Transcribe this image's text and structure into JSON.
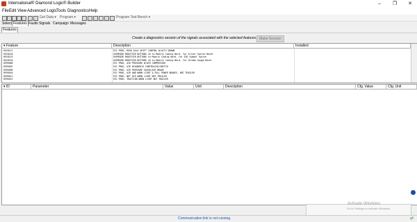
{
  "window": {
    "title": "International® Diamond Logic® Builder",
    "controls": [
      "–",
      "❐",
      "✕"
    ]
  },
  "menu": [
    "File",
    "Edit",
    "View",
    "Advanced Logic",
    "Tools",
    "Diagnostics",
    "Help"
  ],
  "toolbar": {
    "get_data": "Get Data ▾",
    "program": "Program ▾",
    "program_test_bench": "Program Test Bench ▾"
  },
  "tabs": [
    "Select",
    "Features",
    "Faults",
    "Signals",
    "Campaign",
    "Messages"
  ],
  "subtab": "Features",
  "instruction": "Create a diagnostics session of the signals associated with the selected features.",
  "make_session_label": "Make Session",
  "signals_grid": {
    "columns": [
      "Feature",
      "Description",
      "Installed"
    ],
    "rows": [
      [
        "0918211",
        "ESC PROG, REAR AXLE SHIFT CONTROL W/ACTV DRAWB",
        ""
      ],
      [
        "0918218",
        "OVERRIDE MODIFIER BUTTONS 16 to Modify Coding Word, for Silver Switch Bezel",
        ""
      ],
      [
        "0918219",
        "OVERRIDE MODIFIER BUTTONS to Modify Coding Word, for IDS Symbol Switch",
        ""
      ],
      [
        "0918220",
        "OVERRIDE MODIFIER BUTTONS 16 to Modify Coding Word, for Chrome Gauge Bezel",
        ""
      ],
      [
        "0995006",
        "ESC PROG, AIR PRESSURE W/AIR COMPRESSOR",
        ""
      ],
      [
        "0995007",
        "ESC PROG, AIR DIAGNOSIS CONTROLLED/SWITCH",
        ""
      ],
      [
        "0995009",
        "ESC PROG, AIR PRESSURE GAUGE/AIR BRAKE",
        ""
      ],
      [
        "0995010",
        "ESC PROG, AIR AND WARN LIGHT & FULL POWER BRAKES, NOT TRAILER",
        ""
      ],
      [
        "0995011",
        "ESC PROG, NOT AIR WARN LIGHT NOT TRAILER",
        ""
      ],
      [
        "0995012",
        "ESC PROG, TRACTION WARN LIGHT NOT TRAILER",
        ""
      ]
    ]
  },
  "params_grid": {
    "columns": [
      "ID",
      "Parameter",
      "Value",
      "Unit",
      "Description",
      "Cfg. Value",
      "Cfg. Unit"
    ]
  },
  "watermark": {
    "title": "Activate Windows",
    "subtitle": "Go to Settings to activate Windows."
  },
  "status": "Communication link is not running."
}
